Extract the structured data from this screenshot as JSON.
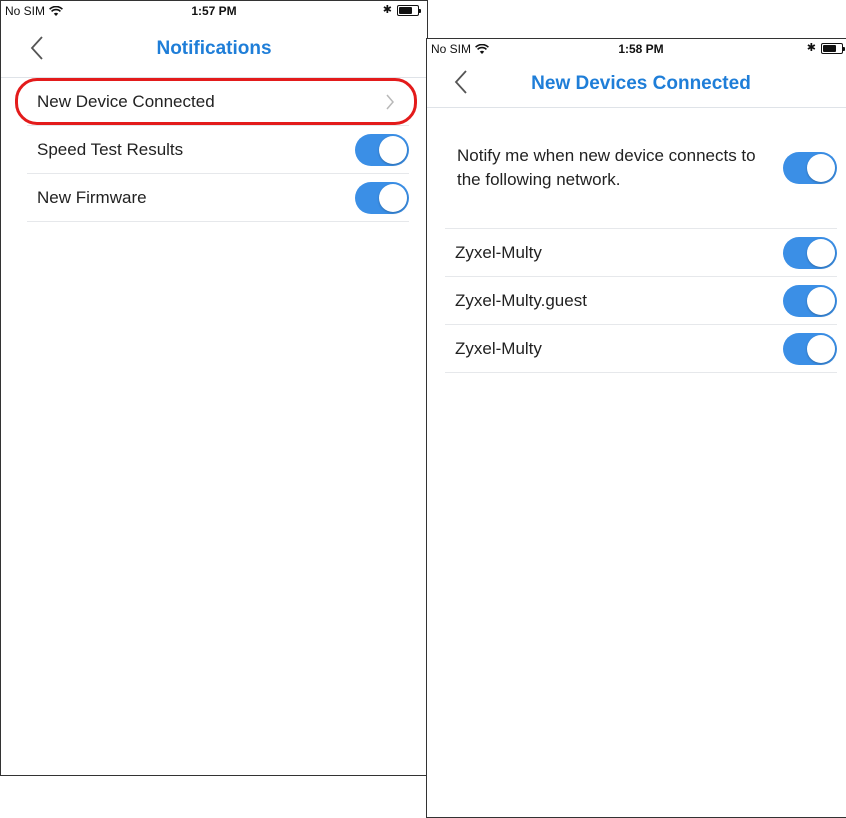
{
  "screen1": {
    "status": {
      "carrier": "No SIM",
      "time": "1:57 PM"
    },
    "title": "Notifications",
    "rows": [
      {
        "label": "New Device Connected",
        "control": "chevron",
        "highlighted": true
      },
      {
        "label": "Speed Test Results",
        "control": "toggle",
        "on": true
      },
      {
        "label": "New Firmware",
        "control": "toggle",
        "on": true
      }
    ]
  },
  "screen2": {
    "status": {
      "carrier": "No SIM",
      "time": "1:58 PM"
    },
    "title": "New Devices Connected",
    "notify_text": "Notify me when new device connects to the following network.",
    "notify_on": true,
    "networks": [
      {
        "label": "Zyxel-Multy",
        "on": true
      },
      {
        "label": "Zyxel-Multy.guest",
        "on": true
      },
      {
        "label": "Zyxel-Multy",
        "on": true
      }
    ]
  },
  "colors": {
    "accent": "#1f7ed8",
    "toggle_on": "#3b8fe6",
    "highlight": "#e31b1b"
  }
}
